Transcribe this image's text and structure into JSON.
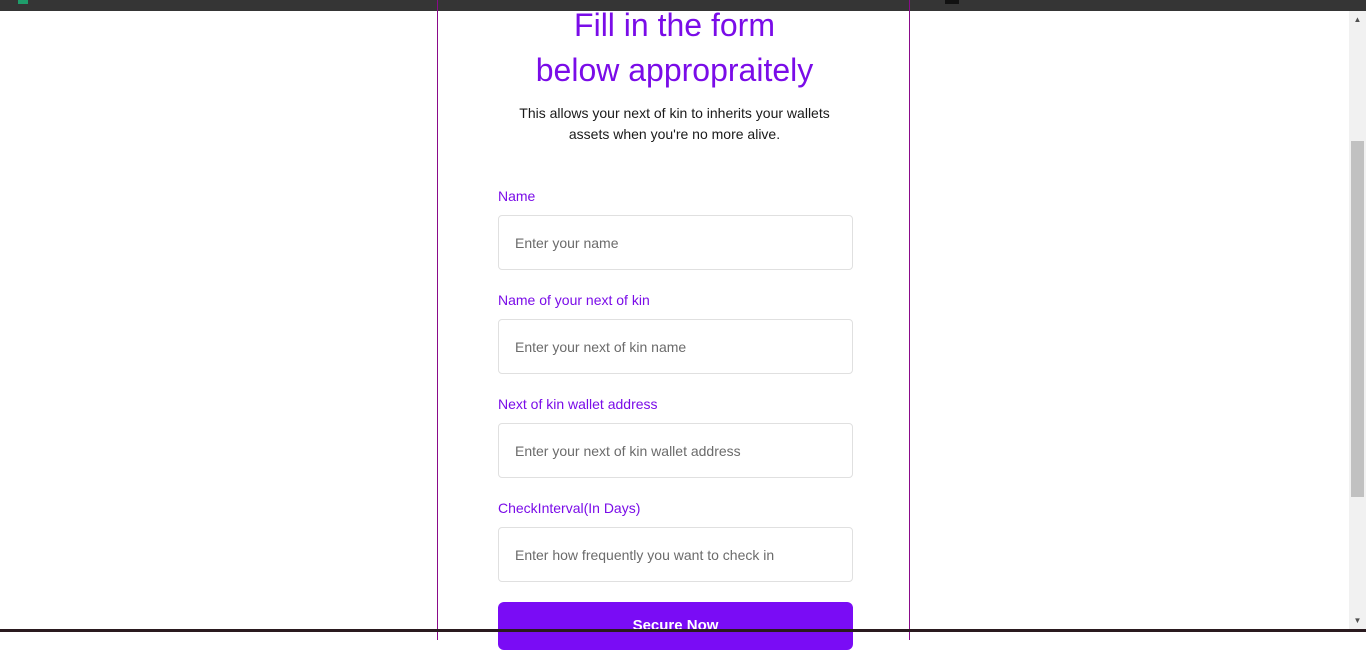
{
  "form": {
    "title_line1": "Fill in the form",
    "title_line2": "below appropraitely",
    "subtitle_line1": "This allows your next of kin to inherits your wallets",
    "subtitle_line2": "assets when you're no more alive.",
    "fields": [
      {
        "label": "Name",
        "placeholder": "Enter your name",
        "value": ""
      },
      {
        "label": "Name of your next of kin",
        "placeholder": "Enter your next of kin name",
        "value": ""
      },
      {
        "label": "Next of kin wallet address",
        "placeholder": "Enter your next of kin wallet address",
        "value": ""
      },
      {
        "label": "CheckInterval(In Days)",
        "placeholder": "Enter how frequently you want to check in",
        "value": ""
      }
    ],
    "submit_label": "Secure Now"
  },
  "colors": {
    "accent": "#7a0ce8",
    "button": "#7a0cf5",
    "card_border": "#8a0a8a",
    "topbar": "#353535"
  },
  "icons": {
    "scroll_up": "scroll-up-arrow-icon",
    "scroll_down": "scroll-down-arrow-icon"
  }
}
